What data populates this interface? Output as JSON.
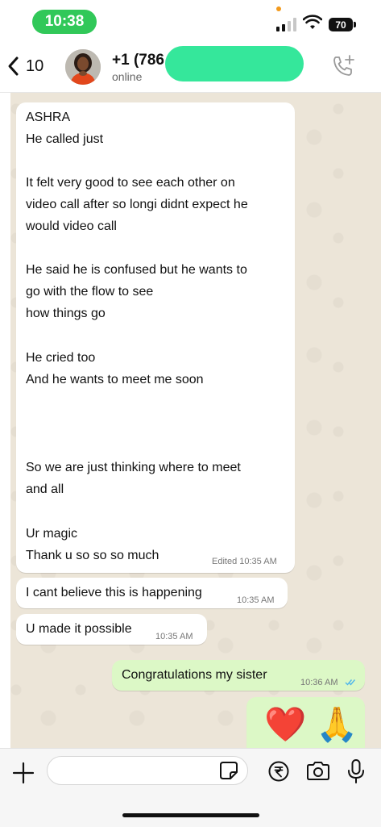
{
  "status_bar": {
    "time": "10:38",
    "battery": "70"
  },
  "header": {
    "back_count": "10",
    "contact_name": "+1 (786",
    "contact_status": "online"
  },
  "messages": [
    {
      "direction": "in",
      "lines": [
        "ASHRA",
        "He called just",
        "",
        "It felt very good to see each other on",
        "video call after so longi didnt expect he",
        "would video call",
        "",
        "He said he is confused but he wants to",
        "go with the flow to see",
        "how things go",
        "",
        "He cried too",
        "And he wants to meet me soon",
        "",
        "",
        "",
        "So we are just thinking where to meet",
        "and all",
        "",
        "Ur magic",
        "Thank u so so so much"
      ],
      "edited_label": "Edited",
      "time": "10:35 AM"
    },
    {
      "direction": "in",
      "text": "I cant believe this is happening",
      "time": "10:35 AM"
    },
    {
      "direction": "in",
      "text": "U made it possible",
      "time": "10:35 AM"
    },
    {
      "direction": "out",
      "text": "Congratulations my sister",
      "time": "10:36 AM",
      "read": true
    },
    {
      "direction": "out",
      "text": "❤️ 🙏"
    }
  ],
  "input_bar": {
    "placeholder": ""
  },
  "colors": {
    "incoming": "#ffffff",
    "outgoing": "#dcf8c6",
    "chat_bg": "#ece5d8",
    "read_ticks": "#4fb6ec",
    "time_pill": "#31c859",
    "redaction": "#35e79b"
  },
  "icons": [
    "back-chevron-icon",
    "add-call-icon",
    "plus-icon",
    "sticker-icon",
    "rupee-icon",
    "camera-icon",
    "microphone-icon",
    "signal-icon",
    "wifi-icon",
    "battery-icon"
  ]
}
